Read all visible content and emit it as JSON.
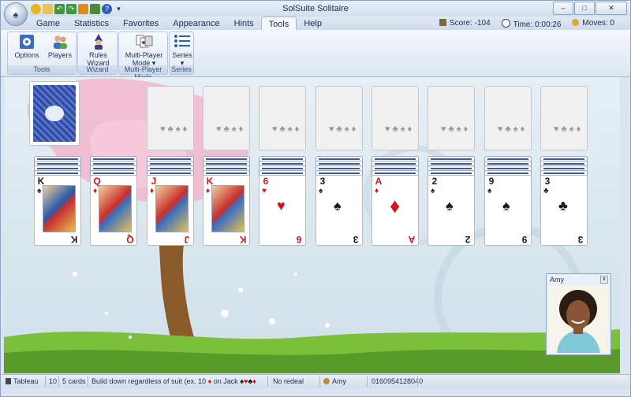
{
  "window": {
    "title": "SolSuite Solitaire"
  },
  "tabs": [
    "Game",
    "Statistics",
    "Favorites",
    "Appearance",
    "Hints",
    "Tools",
    "Help"
  ],
  "active_tab": "Tools",
  "top_status": {
    "score": "Score: -104",
    "time": "Time: 0:00:26",
    "moves": "Moves: 0"
  },
  "ribbon": {
    "groups": [
      {
        "label": "Tools",
        "buttons": [
          "Options",
          "Players"
        ]
      },
      {
        "label": "Wizard",
        "buttons": [
          "Rules Wizard"
        ]
      },
      {
        "label": "Multi-Player Mode",
        "buttons": [
          "Multi-Player Mode"
        ]
      },
      {
        "label": "Series",
        "buttons": [
          "Series"
        ]
      }
    ],
    "rules_wizard_l1": "Rules",
    "rules_wizard_l2": "Wizard",
    "multiplayer_l1": "Multi-Player",
    "multiplayer_l2": "Mode ▾",
    "series_l2": "▾"
  },
  "tableau": [
    {
      "rank": "K",
      "suit": "♠",
      "color": "black",
      "court": true
    },
    {
      "rank": "Q",
      "suit": "♦",
      "color": "red",
      "court": true
    },
    {
      "rank": "J",
      "suit": "♦",
      "color": "red",
      "court": true
    },
    {
      "rank": "K",
      "suit": "♦",
      "color": "red",
      "court": true
    },
    {
      "rank": "6",
      "suit": "♥",
      "color": "red",
      "court": false
    },
    {
      "rank": "3",
      "suit": "♠",
      "color": "black",
      "court": false
    },
    {
      "rank": "A",
      "suit": "♦",
      "color": "red",
      "court": false
    },
    {
      "rank": "2",
      "suit": "♠",
      "color": "black",
      "court": false
    },
    {
      "rank": "9",
      "suit": "♠",
      "color": "black",
      "court": false
    },
    {
      "rank": "3",
      "suit": "♣",
      "color": "black",
      "court": false
    }
  ],
  "foundation_suits": "♥♣♠♦",
  "player": {
    "name": "Amy"
  },
  "statusbar": {
    "game_type": "Tableau",
    "count": "10",
    "cards": "5 cards",
    "rule_part1": "Build down regardless of suit (ex. 10",
    "rule_part2": "on Jack",
    "redeal": "No redeal",
    "player": "Amy",
    "game_number": "0160954128040"
  },
  "colors": {
    "table_bg": "#dce8f0",
    "tree_pink": "#f2b6cc",
    "grass": "#7cbf3a",
    "card_back": "#2f4aa2"
  }
}
